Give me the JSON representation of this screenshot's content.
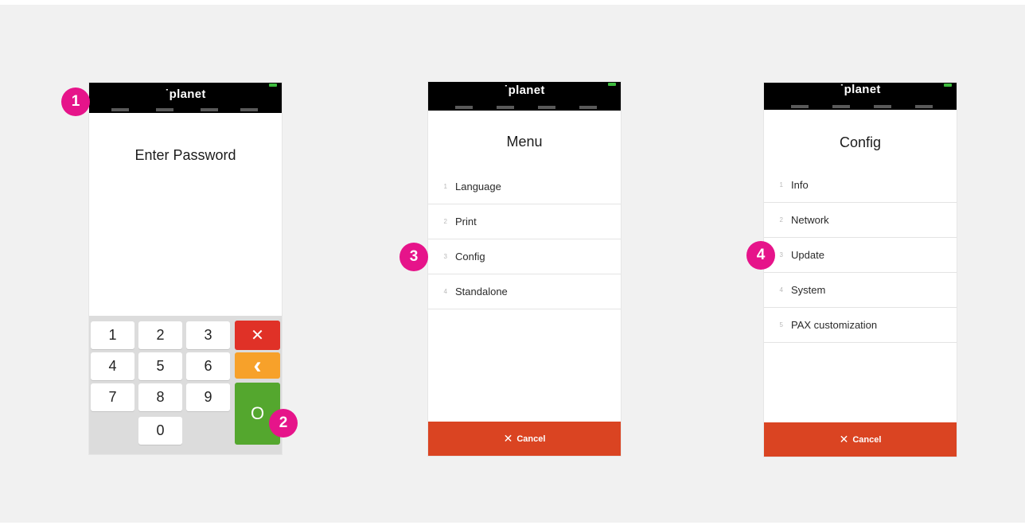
{
  "brand": "˙planet",
  "screen1": {
    "title": "Enter Password",
    "keys": [
      "1",
      "2",
      "3",
      "4",
      "5",
      "6",
      "7",
      "8",
      "9",
      "0"
    ],
    "cancel_glyph": "✕",
    "back_glyph": "‹",
    "ok_glyph": "O"
  },
  "screen2": {
    "title": "Menu",
    "items": [
      {
        "num": "1",
        "label": "Language"
      },
      {
        "num": "2",
        "label": "Print"
      },
      {
        "num": "3",
        "label": "Config"
      },
      {
        "num": "4",
        "label": "Standalone"
      }
    ],
    "cancel_icon": "✕",
    "cancel_label": "Cancel"
  },
  "screen3": {
    "title": "Config",
    "items": [
      {
        "num": "1",
        "label": "Info"
      },
      {
        "num": "2",
        "label": "Network"
      },
      {
        "num": "3",
        "label": "Update"
      },
      {
        "num": "4",
        "label": "System"
      },
      {
        "num": "5",
        "label": "PAX customization"
      }
    ],
    "cancel_icon": "✕",
    "cancel_label": "Cancel"
  },
  "badges": [
    "1",
    "2",
    "3",
    "4"
  ],
  "colors": {
    "badge": "#e6148a",
    "cancel_red": "#e03127",
    "back_orange": "#f7a12a",
    "ok_green": "#54a72e",
    "cancel_bar": "#da4422"
  }
}
